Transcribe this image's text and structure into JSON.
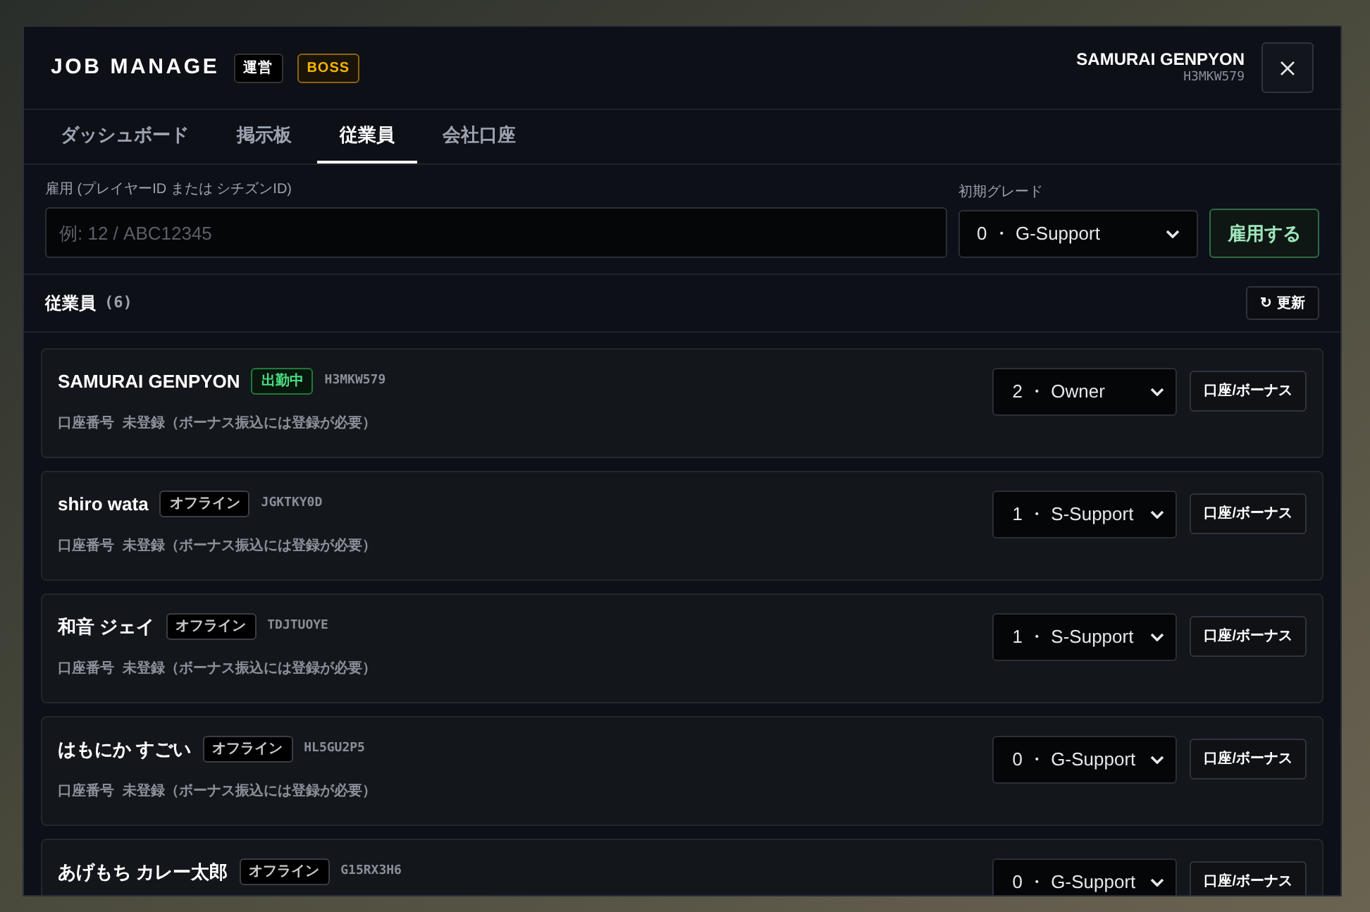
{
  "window": {
    "title": "JOB MANAGE",
    "badges": [
      {
        "label": "運営",
        "kind": "plain"
      },
      {
        "label": "BOSS",
        "kind": "gold"
      }
    ]
  },
  "user": {
    "name": "SAMURAI GENPYON",
    "id": "H3MKW579"
  },
  "tabs": [
    {
      "label": "ダッシュボード",
      "selected": false
    },
    {
      "label": "掲示板",
      "selected": false
    },
    {
      "label": "従業員",
      "selected": true
    },
    {
      "label": "会社口座",
      "selected": false
    }
  ],
  "hire": {
    "id_label": "雇用 (プレイヤーID または シチズンID)",
    "placeholder": "例: 12 / ABC12345",
    "grade_label": "初期グレード",
    "grade_value": "0 ・ G-Support",
    "button": "雇用する"
  },
  "list_header": {
    "title": "従業員",
    "count": "(6)",
    "refresh": "更新",
    "refresh_icon": "↻"
  },
  "employees": [
    {
      "name": "SAMURAI GENPYON",
      "status": "出勤中",
      "kind": "online",
      "id": "H3MKW579",
      "account_label": "口座番号",
      "account_value": "未登録（ボーナス振込には登録が必要）",
      "grade": "2 ・ Owner",
      "action": "口座/ボーナス"
    },
    {
      "name": "shiro wata",
      "status": "オフライン",
      "kind": "offline",
      "id": "JGKTKY0D",
      "account_label": "口座番号",
      "account_value": "未登録（ボーナス振込には登録が必要）",
      "grade": "1 ・ S-Support",
      "action": "口座/ボーナス"
    },
    {
      "name": "和音 ジェイ",
      "status": "オフライン",
      "kind": "offline",
      "id": "TDJTUOYE",
      "account_label": "口座番号",
      "account_value": "未登録（ボーナス振込には登録が必要）",
      "grade": "1 ・ S-Support",
      "action": "口座/ボーナス"
    },
    {
      "name": "はもにか すごい",
      "status": "オフライン",
      "kind": "offline",
      "id": "HL5GU2P5",
      "account_label": "口座番号",
      "account_value": "未登録（ボーナス振込には登録が必要）",
      "grade": "0 ・ G-Support",
      "action": "口座/ボーナス"
    },
    {
      "name": "あげもち カレー太郎",
      "status": "オフライン",
      "kind": "offline",
      "id": "G15RX3H6",
      "grade": "0 ・ G-Support",
      "action": "口座/ボーナス"
    }
  ]
}
